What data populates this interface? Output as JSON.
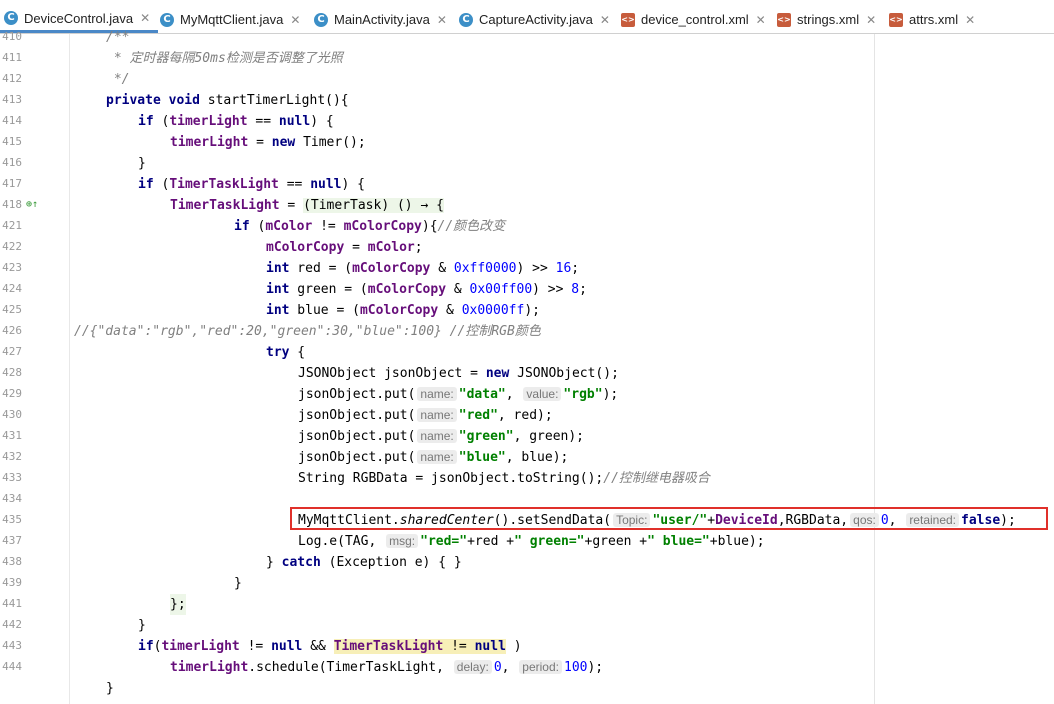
{
  "tabs": [
    {
      "label": "DeviceControl.java",
      "icon": "java-class-icon",
      "active": true
    },
    {
      "label": "MyMqttClient.java",
      "icon": "java-class-icon"
    },
    {
      "label": "MainActivity.java",
      "icon": "java-class-icon"
    },
    {
      "label": "CaptureActivity.java",
      "icon": "java-class-icon"
    },
    {
      "label": "device_control.xml",
      "icon": "xml-file-icon"
    },
    {
      "label": "strings.xml",
      "icon": "xml-file-icon"
    },
    {
      "label": "attrs.xml",
      "icon": "xml-file-icon"
    }
  ],
  "line_numbers": [
    "410",
    "411",
    "412",
    "413",
    "414",
    "415",
    "416",
    "417",
    "418",
    "421",
    "422",
    "423",
    "424",
    "425",
    "426",
    "427",
    "428",
    "429",
    "430",
    "431",
    "432",
    "433",
    "434",
    "435",
    "437",
    "438",
    "439",
    "441",
    "442",
    "443",
    "444"
  ],
  "code": {
    "l410": "/**",
    "l411": " * 定时器每隔50ms检测是否调整了光照",
    "l412": " */",
    "l413_kw": "private void",
    "l413_rest": " startTimerLight(){",
    "if": "if",
    "null": "null",
    "new": "new",
    "int": "int",
    "try": "try",
    "catch": "catch",
    "timerLight": "timerLight",
    "TimerTaskLight": "TimerTaskLight",
    "mColor": "mColor",
    "mColorCopy": "mColorCopy",
    "eqnull": " == ",
    "l414_end": ") {",
    "l415_mid": " = ",
    "l415_end": " Timer();",
    "brace_close": "}",
    "l418_mid": " = ",
    "l418_lambda": "(TimerTask) () → {",
    "l421_open": " (",
    "l421_ne": " != ",
    "l421_end": "){",
    "l421_cm": "//颜色改变",
    "l422_mid": " = ",
    "semi": ";",
    "red_decl": " red = (",
    "green_decl": " green = (",
    "blue_decl": " blue = (",
    "amp": " & ",
    "hex_red": "0xff0000",
    "hex_green": "0x00ff00",
    "hex_blue": "0x0000ff",
    "shift_close": ") >> ",
    "n16": "16",
    "n8": "8",
    "blue_end": ");",
    "l426": "//{\"data\":\"rgb\",\"red\":20,\"green\":30,\"blue\":100} //控制RGB颜色",
    "try_open": " {",
    "l428_a": "JSONObject jsonObject = ",
    "l428_b": " JSONObject();",
    "put_open": "jsonObject.put(",
    "hint_name": "name:",
    "hint_value": "value:",
    "s_data": "\"data\"",
    "s_rgb": "\"rgb\"",
    "s_red": "\"red\"",
    "s_green": "\"green\"",
    "s_blue": "\"blue\"",
    "comma": ", ",
    "paren_semi": ");",
    "red_arg": ", red);",
    "green_arg": ", green);",
    "blue_arg": ", blue);",
    "l433": "String RGBData = jsonObject.toString();",
    "l433_cm": "//控制继电器吸合",
    "l435_a": "MyMqttClient.",
    "l435_sc": "sharedCenter",
    "l435_b": "().setSendData(",
    "hint_topic": "Topic:",
    "s_user": "\"user/\"",
    "l435_c": "+",
    "DeviceId": "DeviceId",
    "l435_d": ",RGBData,",
    "hint_qos": "qos:",
    "n0": "0",
    "hint_retained": "retained:",
    "false": "false",
    "l437_a": "Log.e(TAG,",
    "hint_msg": "msg:",
    "s_red_eq": "\"red=\"",
    "l437_b": "+red +",
    "s_green_eq": "\" green=\"",
    "l437_c": "+green +",
    "s_blue_eq": "\" blue=\"",
    "l437_d": "+blue);",
    "catch_pre": "} ",
    "catch_post": " (Exception e) { }",
    "lambda_end": "};",
    "l442_a": "(",
    "l442_ne": " != ",
    "l442_and": " && ",
    "l442_end": " )",
    "l443_b": ".schedule(TimerTaskLight,",
    "hint_delay": "delay:",
    "hint_period": "period:",
    "n100": "100"
  }
}
